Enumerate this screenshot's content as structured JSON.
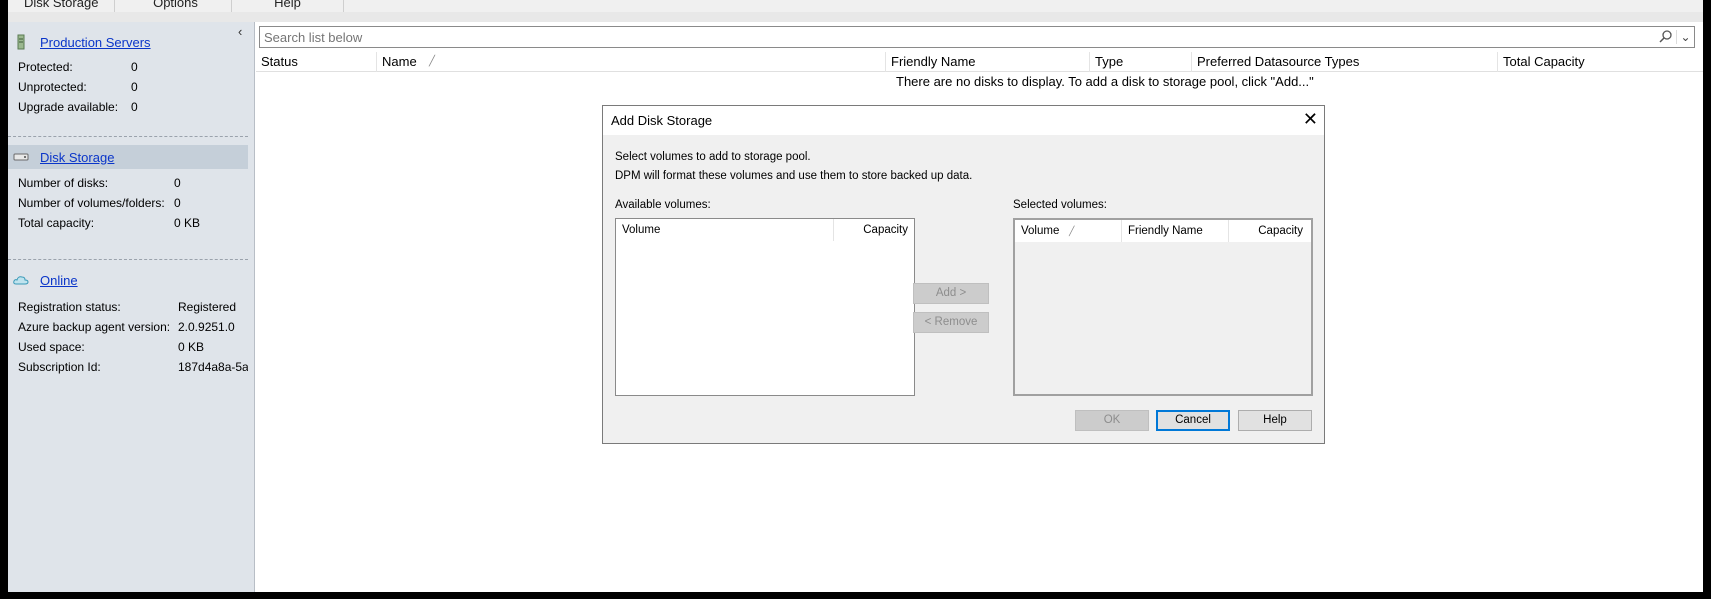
{
  "ribbon": {
    "tabs": [
      "Disk Storage",
      "Options",
      "Help"
    ]
  },
  "nav": {
    "collapse_icon": "chevron-left",
    "production": {
      "title": "Production Servers",
      "rows": [
        {
          "label": "Protected:",
          "value": "0"
        },
        {
          "label": "Unprotected:",
          "value": "0"
        },
        {
          "label": "Upgrade available:",
          "value": "0"
        }
      ]
    },
    "disk": {
      "title": "Disk Storage",
      "rows": [
        {
          "label": "Number of disks:",
          "value": "0"
        },
        {
          "label": "Number of volumes/folders:",
          "value": "0"
        },
        {
          "label": "Total capacity:",
          "value": "0 KB"
        }
      ]
    },
    "online": {
      "title": "Online",
      "rows": [
        {
          "label": "Registration status:",
          "value": "Registered"
        },
        {
          "label": "Azure backup agent version:",
          "value": "2.0.9251.0"
        },
        {
          "label": "Used space:",
          "value": "0 KB"
        },
        {
          "label": "Subscription Id:",
          "value": "187d4a8a-5a"
        }
      ]
    }
  },
  "main": {
    "search_placeholder": "Search list below",
    "columns": [
      "Status",
      "Name",
      "Friendly Name",
      "Type",
      "Preferred Datasource Types",
      "Total Capacity"
    ],
    "empty_message": "There are no disks to display. To add a disk to storage pool, click \"Add...\""
  },
  "dialog": {
    "title": "Add Disk Storage",
    "line1": "Select volumes to add to storage pool.",
    "line2": "DPM will format these volumes and use them to store backed up data.",
    "available_label": "Available volumes:",
    "available_columns": [
      "Volume",
      "Capacity"
    ],
    "selected_label": "Selected volumes:",
    "selected_columns": [
      "Volume",
      "Friendly Name",
      "Capacity"
    ],
    "add_label": "Add >",
    "remove_label": "< Remove",
    "ok_label": "OK",
    "cancel_label": "Cancel",
    "help_label": "Help"
  },
  "colors": {
    "link": "#0a35c9",
    "nav_bg": "#dfe4ea",
    "selected_section": "#c5cfd9",
    "focus_border": "#0078d7"
  }
}
